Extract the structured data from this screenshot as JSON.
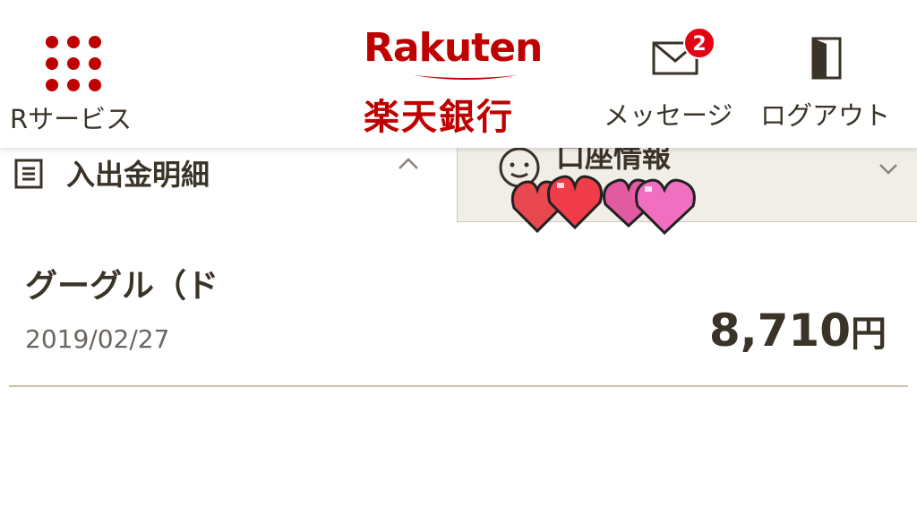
{
  "colors": {
    "brand": "#bf0000",
    "badge": "#e60012",
    "text": "#3a3328",
    "subtext": "#6b6560",
    "panel": "#f1eee8",
    "divider": "#cfc2ad"
  },
  "header": {
    "services": {
      "label": "Rサービス",
      "icon": "grid-icon"
    },
    "logo": {
      "word": "Rakuten",
      "bank_name": "楽天銀行"
    },
    "messages": {
      "label": "メッセージ",
      "badge_count": "2",
      "icon": "mail-icon"
    },
    "logout": {
      "label": "ログアウト",
      "icon": "door-icon"
    }
  },
  "sections": {
    "transactions": {
      "title": "入出金明細",
      "icon": "list-icon",
      "state": "expanded"
    },
    "account": {
      "title": "口座情報",
      "icon": "face-icon",
      "state": "collapsed"
    }
  },
  "decoration": {
    "sticker": "pixel-hearts-icon"
  },
  "transactions": [
    {
      "name": "グーグル（ド",
      "date": "2019/02/27",
      "amount": "8,710",
      "unit": "円"
    }
  ]
}
